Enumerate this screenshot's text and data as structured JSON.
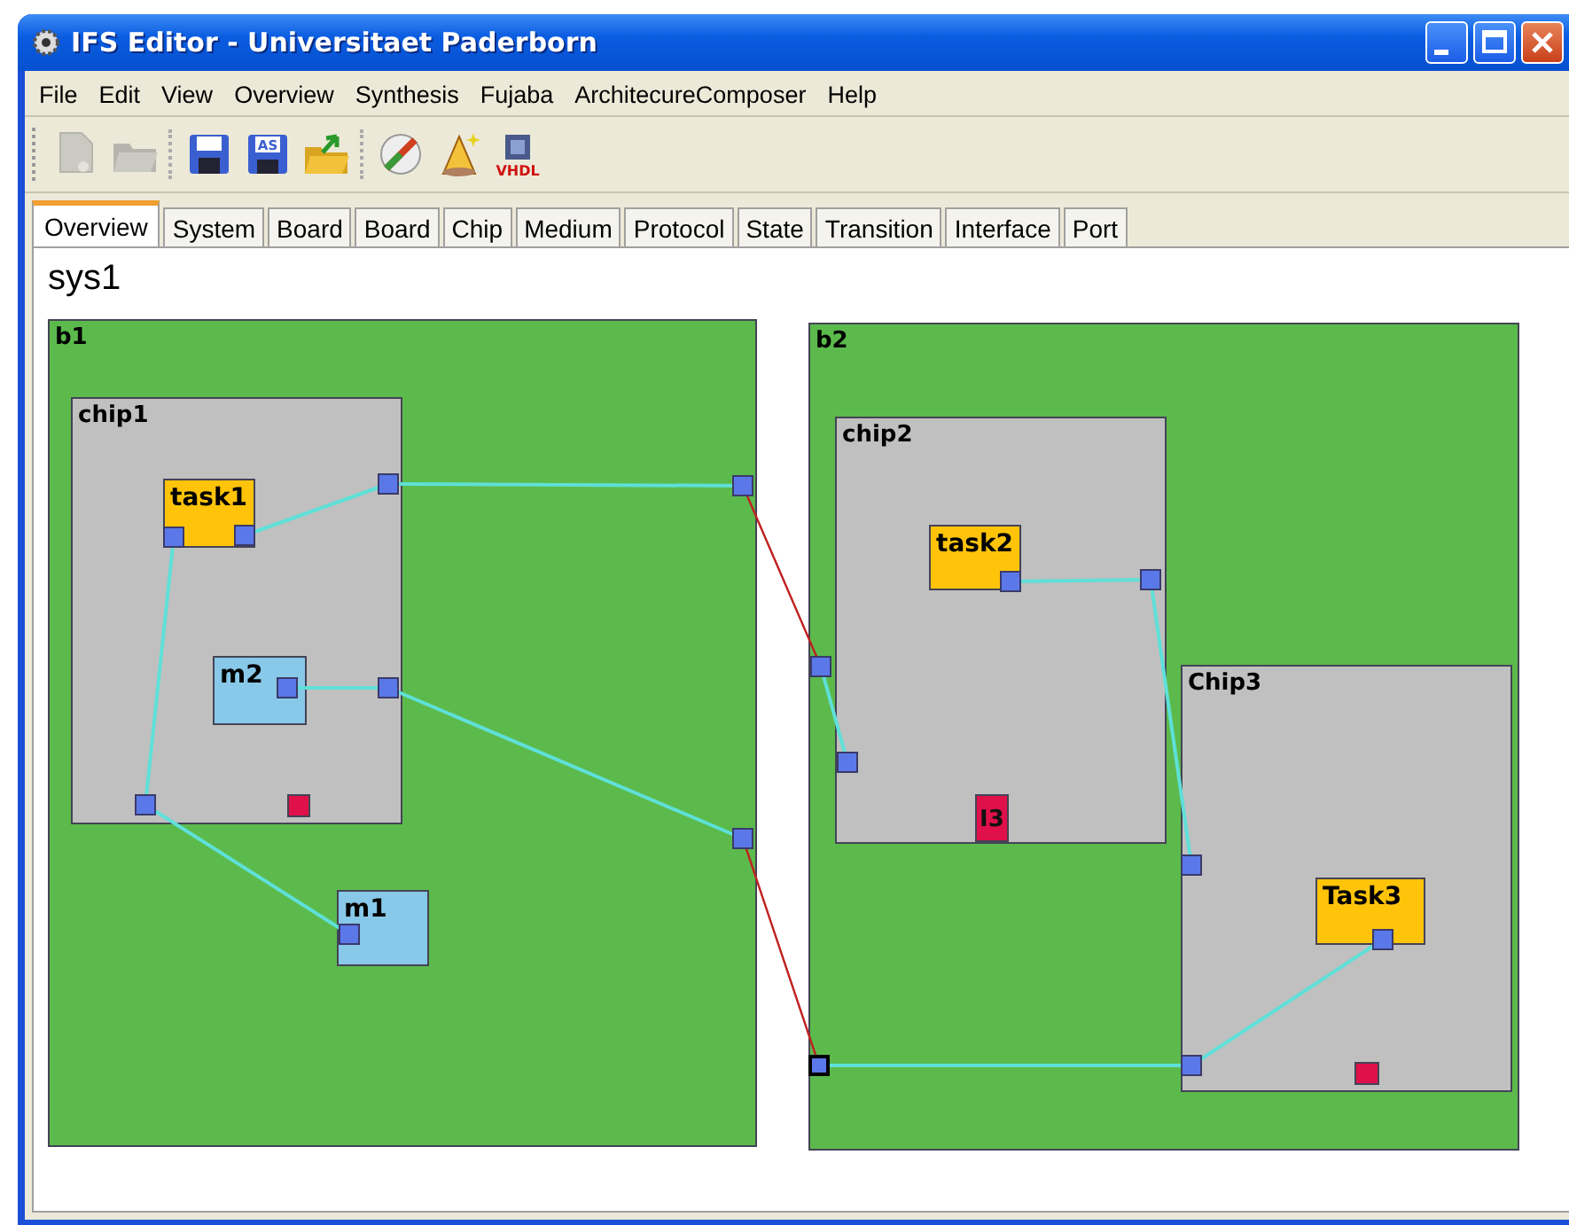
{
  "window": {
    "title": "IFS Editor - Universitaet Paderborn"
  },
  "menu": [
    "File",
    "Edit",
    "View",
    "Overview",
    "Synthesis",
    "Fujaba",
    "ArchitecureComposer",
    "Help"
  ],
  "toolbar": [
    {
      "kind": "new",
      "disabled": true
    },
    {
      "kind": "open",
      "disabled": true
    },
    {
      "kind": "save",
      "disabled": false
    },
    {
      "kind": "saveas",
      "disabled": false,
      "label": "AS"
    },
    {
      "kind": "export",
      "disabled": false
    },
    {
      "kind": "check",
      "disabled": false
    },
    {
      "kind": "wizard",
      "disabled": false
    },
    {
      "kind": "vhdl",
      "disabled": false,
      "label": "VHDL"
    }
  ],
  "tabs": [
    {
      "label": "Overview",
      "selected": true
    },
    {
      "label": "System",
      "selected": false
    },
    {
      "label": "Board",
      "selected": false
    },
    {
      "label": "Board",
      "selected": false
    },
    {
      "label": "Chip",
      "selected": false
    },
    {
      "label": "Medium",
      "selected": false
    },
    {
      "label": "Protocol",
      "selected": false
    },
    {
      "label": "State",
      "selected": false
    },
    {
      "label": "Transition",
      "selected": false
    },
    {
      "label": "Interface",
      "selected": false
    },
    {
      "label": "Port",
      "selected": false
    }
  ],
  "diagram": {
    "title": "sys1",
    "boards": [
      {
        "name": "b1",
        "children": [
          {
            "kind": "chip",
            "name": "chip1",
            "children": [
              {
                "kind": "task",
                "name": "task1"
              },
              {
                "kind": "memory",
                "name": "m2"
              },
              {
                "kind": "interface"
              }
            ]
          },
          {
            "kind": "memory",
            "name": "m1"
          }
        ]
      },
      {
        "name": "b2",
        "children": [
          {
            "kind": "chip",
            "name": "chip2",
            "children": [
              {
                "kind": "task",
                "name": "task2"
              },
              {
                "kind": "interface",
                "name": "I3"
              }
            ]
          },
          {
            "kind": "chip",
            "name": "Chip3",
            "children": [
              {
                "kind": "task",
                "name": "Task3"
              },
              {
                "kind": "interface"
              }
            ]
          }
        ]
      }
    ]
  }
}
